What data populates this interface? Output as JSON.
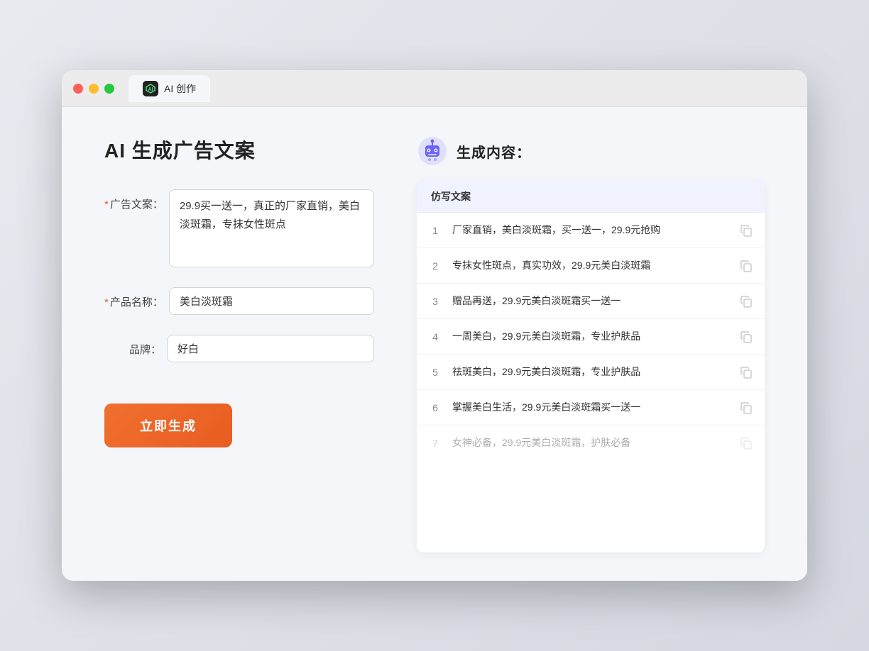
{
  "window": {
    "tab_label": "AI 创作"
  },
  "left_panel": {
    "page_title": "AI 生成广告文案",
    "fields": [
      {
        "id": "ad_copy",
        "label": "广告文案：",
        "required": true,
        "type": "textarea",
        "value": "29.9买一送一，真正的厂家直销，美白淡斑霜，专抹女性斑点"
      },
      {
        "id": "product_name",
        "label": "产品名称：",
        "required": true,
        "type": "input",
        "value": "美白淡斑霜"
      },
      {
        "id": "brand",
        "label": "品牌：",
        "required": false,
        "type": "input",
        "value": "好白"
      }
    ],
    "generate_button": "立即生成"
  },
  "right_panel": {
    "title": "生成内容：",
    "table_header": "仿写文案",
    "results": [
      {
        "num": "1",
        "text": "厂家直销，美白淡斑霜，买一送一，29.9元抢购",
        "dimmed": false
      },
      {
        "num": "2",
        "text": "专抹女性斑点，真实功效，29.9元美白淡斑霜",
        "dimmed": false
      },
      {
        "num": "3",
        "text": "赠品再送，29.9元美白淡斑霜买一送一",
        "dimmed": false
      },
      {
        "num": "4",
        "text": "一周美白，29.9元美白淡斑霜，专业护肤品",
        "dimmed": false
      },
      {
        "num": "5",
        "text": "祛斑美白，29.9元美白淡斑霜，专业护肤品",
        "dimmed": false
      },
      {
        "num": "6",
        "text": "掌握美白生活，29.9元美白淡斑霜买一送一",
        "dimmed": false
      },
      {
        "num": "7",
        "text": "女神必备，29.9元美白淡斑霜，护肤必备",
        "dimmed": true
      }
    ]
  },
  "colors": {
    "accent_orange": "#e85c20",
    "required_star": "#e85c2c",
    "tab_icon_bg": "#222222",
    "tab_icon_color": "#4ade80"
  }
}
